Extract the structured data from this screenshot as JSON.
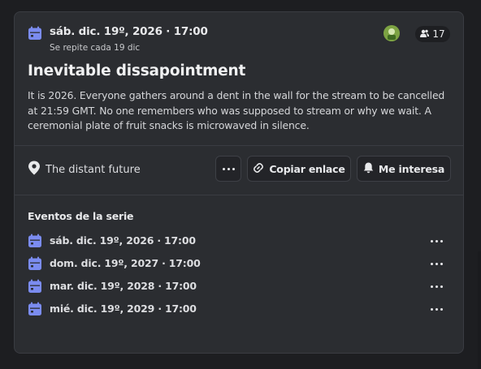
{
  "event": {
    "date": "sáb. dic. 19º, 2026 · 17:00",
    "repeat": "Se repite cada 19 dic",
    "interested_count": "17",
    "title": "Inevitable dissapointment",
    "description": "It is 2026. Everyone gathers around a dent in the wall for the stream to be cancelled at 21:59 GMT. No one remembers who was supposed to stream or why we wait. A ceremonial plate of fruit snacks is microwaved in silence.",
    "location": "The distant future"
  },
  "actions": {
    "copy_link": "Copiar enlace",
    "interested": "Me interesa"
  },
  "series": {
    "heading": "Eventos de la serie",
    "items": [
      {
        "label": "sáb. dic. 19º, 2026 · 17:00"
      },
      {
        "label": "dom. dic. 19º, 2027 · 17:00"
      },
      {
        "label": "mar. dic. 19º, 2028 · 17:00"
      },
      {
        "label": "mié. dic. 19º, 2029 · 17:00"
      }
    ]
  },
  "colors": {
    "accent": "#7b8cf0",
    "card": "#2b2d31",
    "background": "#1d1e21"
  },
  "icons": [
    "calendar-icon",
    "people-icon",
    "location-pin-icon",
    "link-icon",
    "bell-icon",
    "more-dots-icon"
  ]
}
